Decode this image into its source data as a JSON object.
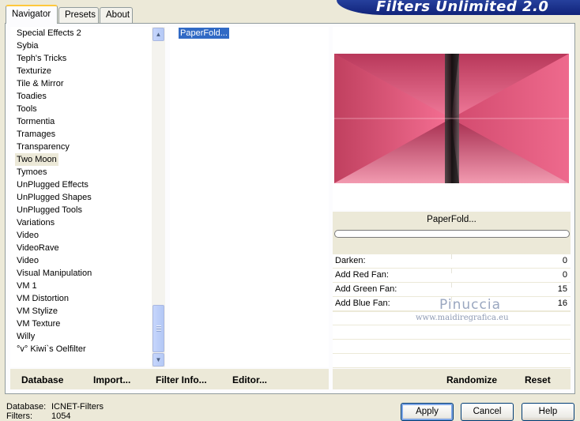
{
  "tabs": [
    "Navigator",
    "Presets",
    "About"
  ],
  "banner_title": "Filters Unlimited 2.0",
  "categories": [
    "Special Effects 2",
    "Sybia",
    "Teph's Tricks",
    "Texturize",
    "Tile & Mirror",
    "Toadies",
    "Tools",
    "Tormentia",
    "Tramages",
    "Transparency",
    "Two Moon",
    "Tymoes",
    "UnPlugged Effects",
    "UnPlugged Shapes",
    "UnPlugged Tools",
    "Variations",
    "Video",
    "VideoRave",
    "Video",
    "Visual Manipulation",
    "VM 1",
    "VM Distortion",
    "VM Stylize",
    "VM Texture",
    "Willy",
    "°v° Kiwi`s Oelfilter"
  ],
  "selected_category": "Two Moon",
  "filters": [
    "PaperFold..."
  ],
  "selected_filter": "PaperFold...",
  "filter_name": "PaperFold...",
  "params": [
    {
      "label": "Darken:",
      "value": "0"
    },
    {
      "label": "Add Red Fan:",
      "value": "0"
    },
    {
      "label": "Add Green Fan:",
      "value": "15"
    },
    {
      "label": "Add Blue Fan:",
      "value": "16"
    }
  ],
  "watermark": {
    "name": "Pinuccia",
    "url": "www.maidiregrafica.eu"
  },
  "left_buttons": [
    "Database",
    "Import...",
    "Filter Info...",
    "Editor..."
  ],
  "right_buttons": [
    "Randomize",
    "Reset"
  ],
  "status": {
    "database_label": "Database:",
    "database_value": "ICNET-Filters",
    "filters_label": "Filters:",
    "filters_value": "1054"
  },
  "dialog_buttons": {
    "apply": "Apply",
    "cancel": "Cancel",
    "help": "Help"
  },
  "colors": {
    "accent_selection": "#316ac5",
    "banner": "#10237a",
    "preview_pink": "#e8557c"
  }
}
